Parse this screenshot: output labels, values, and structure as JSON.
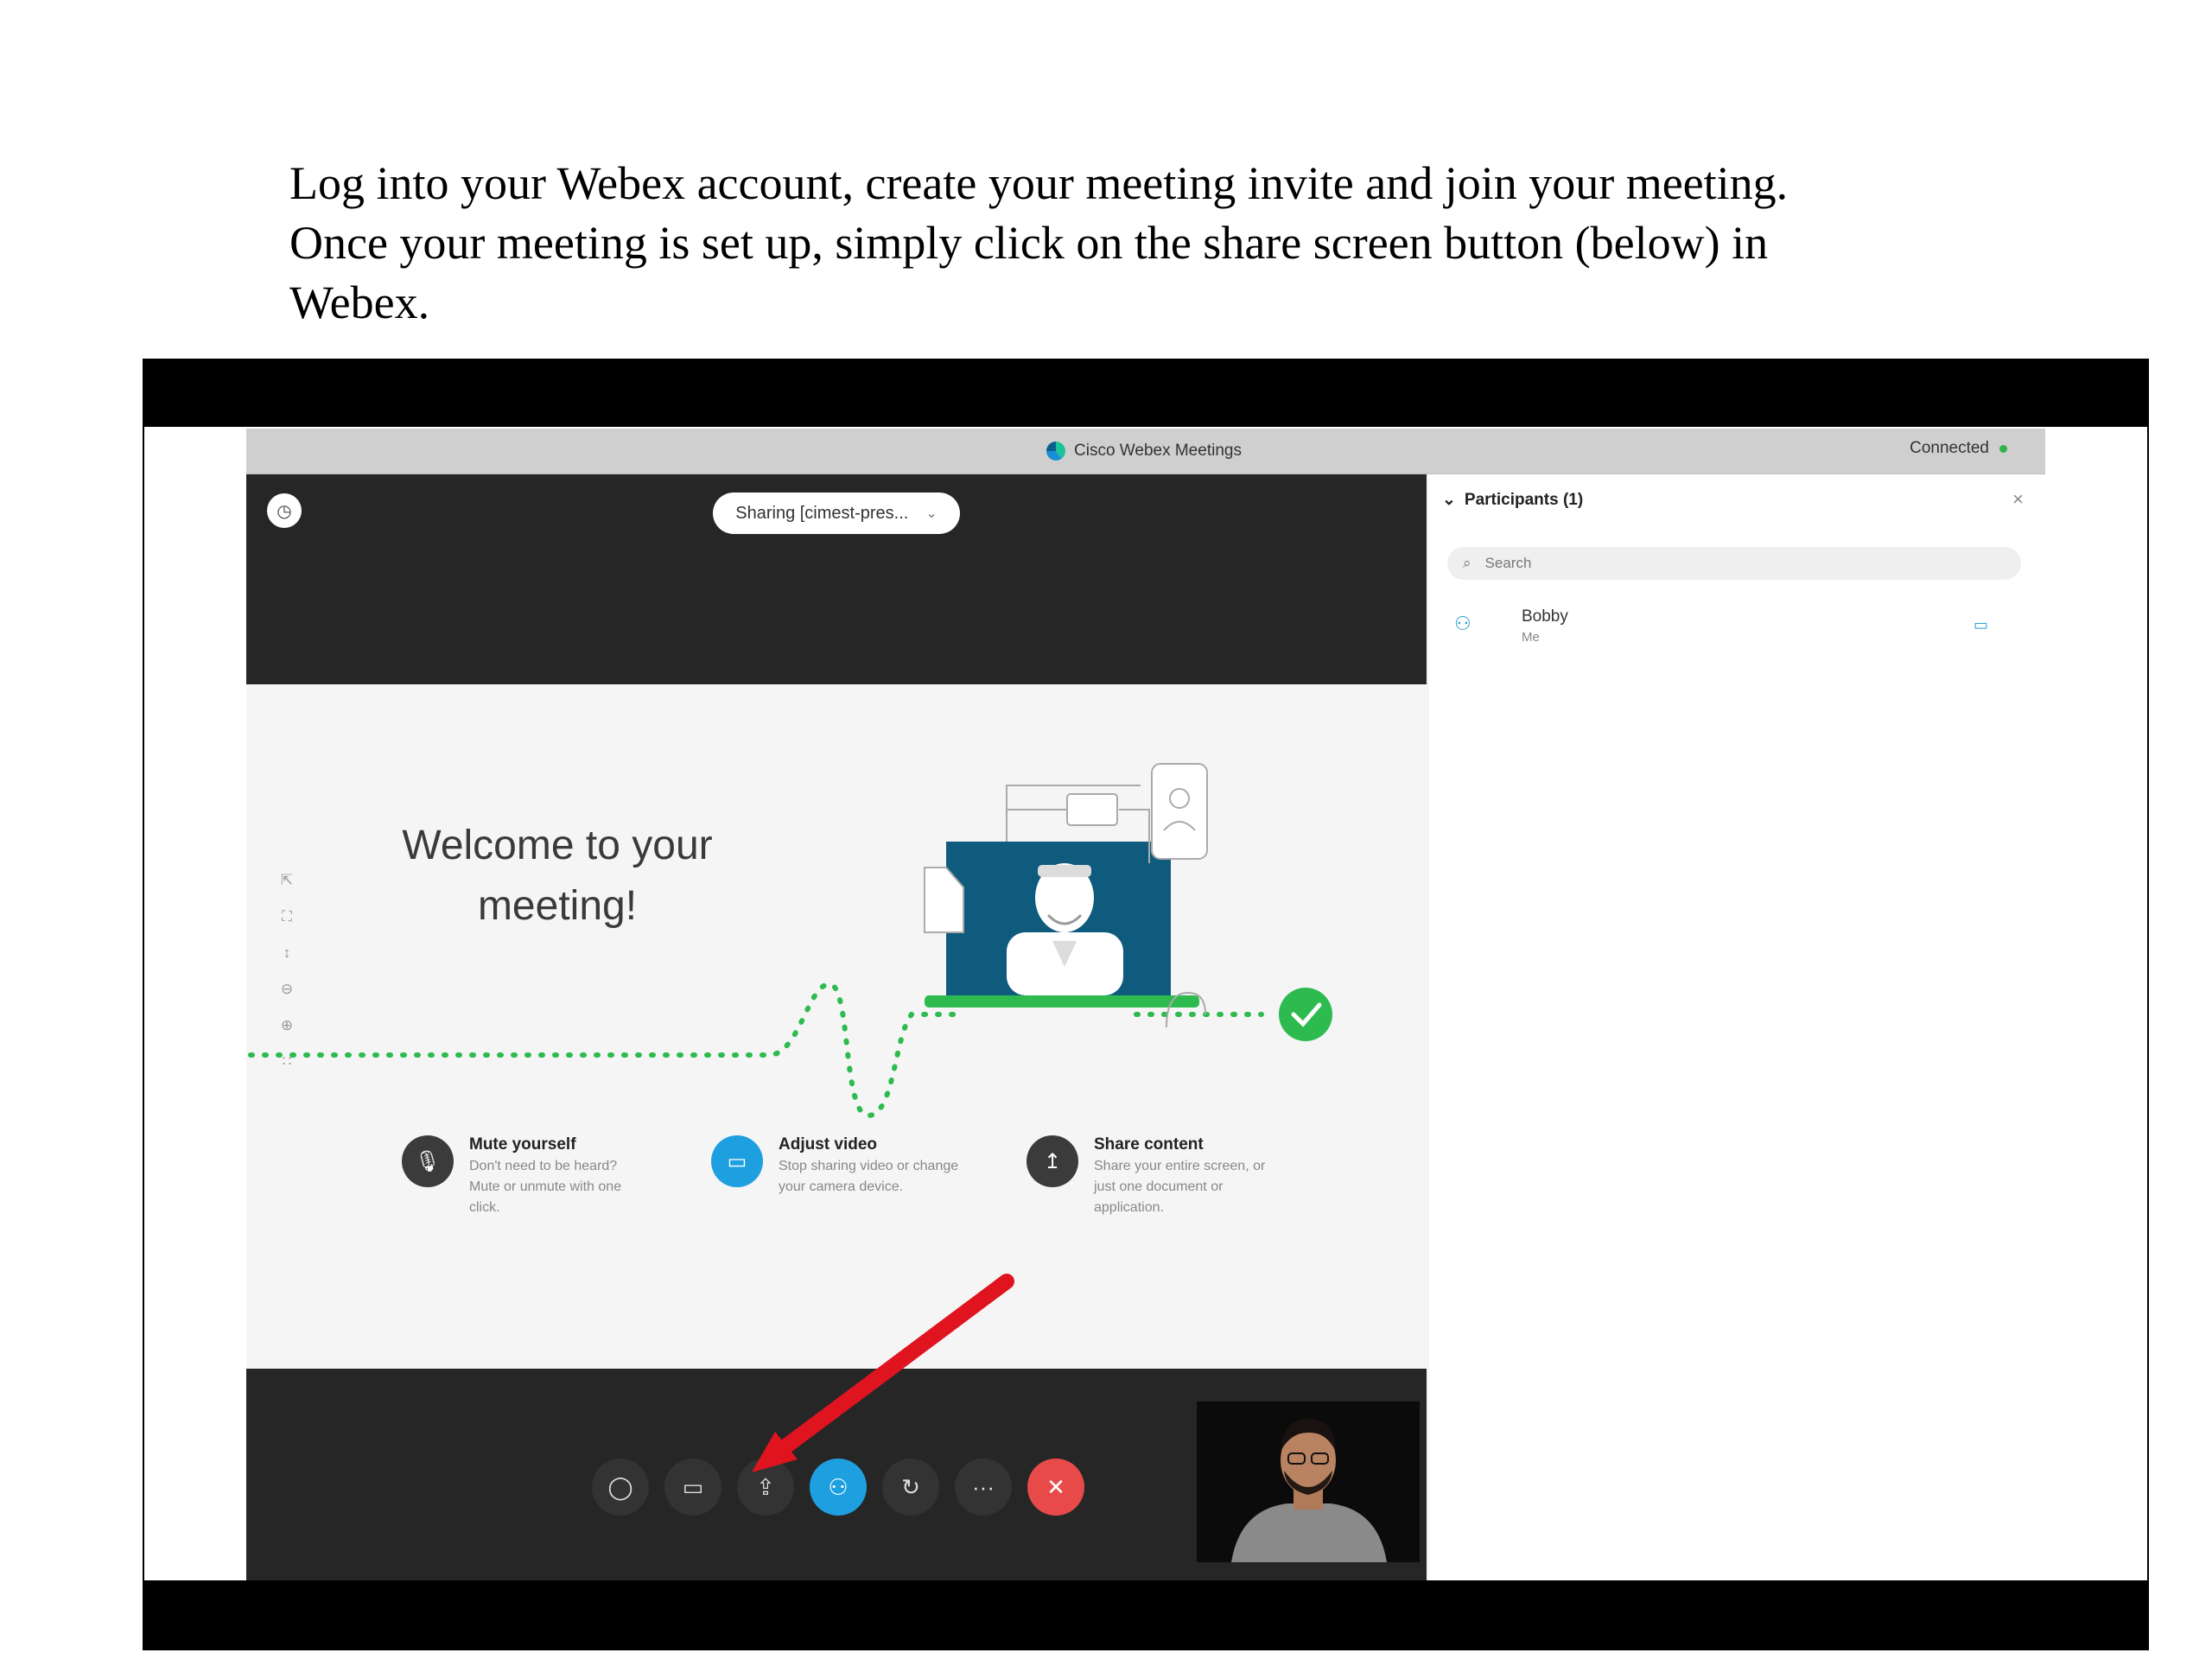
{
  "instructions": {
    "line1": "Log into your Webex account, create your meeting invite and join your meeting.",
    "line2": "Once your meeting is set up, simply click on the share screen button (below) in",
    "line3": "Webex."
  },
  "window": {
    "title": "Cisco Webex Meetings",
    "status": "Connected",
    "status_color": "#2cb34a"
  },
  "stage": {
    "sharing_label": "Sharing [cimest-pres...",
    "welcome_line1": "Welcome to your",
    "welcome_line2": "meeting!",
    "features": [
      {
        "title": "Mute yourself",
        "desc": "Don't need to be heard? Mute or unmute with one click.",
        "icon": "microphone-icon",
        "color": "#3b3b3b"
      },
      {
        "title": "Adjust video",
        "desc": "Stop sharing video or change your camera device.",
        "icon": "video-camera-icon",
        "color": "#1e9fe0"
      },
      {
        "title": "Share content",
        "desc": "Share your entire screen, or just one document or application.",
        "icon": "share-upload-icon",
        "color": "#3b3b3b"
      }
    ]
  },
  "controls": [
    "mute-icon",
    "video-icon",
    "share-screen-icon",
    "participants-icon",
    "reactions-icon",
    "more-icon",
    "end-call-icon"
  ],
  "participants": {
    "header": "Participants (1)",
    "search_placeholder": "Search",
    "people": [
      {
        "name": "Bobby",
        "sub": "Me"
      }
    ]
  },
  "colors": {
    "accent_blue": "#1e9fe0",
    "end_red": "#e84a4a",
    "path_green": "#2dbb4f",
    "arrow_red": "#e0141e"
  }
}
